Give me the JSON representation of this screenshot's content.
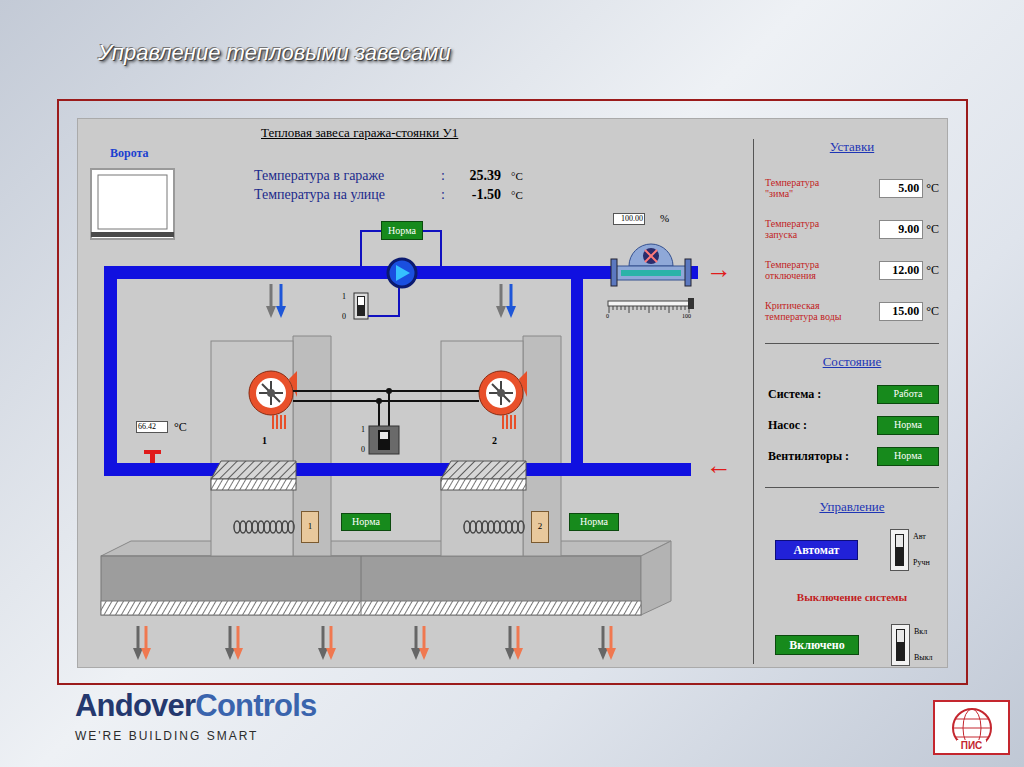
{
  "slide": {
    "title": "Управление тепловыми завесами"
  },
  "diagram": {
    "title": "Тепловая завеса гаража-стоянки У1",
    "gate": {
      "label": "Ворота"
    },
    "readings": [
      {
        "label": "Температура в гараже",
        "separator": ":",
        "value": "25.39",
        "unit": "°C"
      },
      {
        "label": "Температура на улице",
        "separator": ":",
        "value": "-1.50",
        "unit": "°C"
      }
    ],
    "pump": {
      "status": "Норма",
      "switch": {
        "on_label": "1",
        "off_label": "0",
        "on": true
      }
    },
    "valve": {
      "value": "100.00",
      "unit": "%",
      "level": 1,
      "scale_min": "0",
      "scale_max": "100"
    },
    "flow": {
      "supply_arrow": "→",
      "return_arrow": "←"
    },
    "water_temperature": {
      "value": "66.42",
      "unit": "°C"
    },
    "fan_switch": {
      "on_label": "1",
      "off_label": "0",
      "on": true
    },
    "units": [
      {
        "number": "1",
        "heater_label": "1",
        "status": "Норма"
      },
      {
        "number": "2",
        "heater_label": "2",
        "status": "Норма"
      }
    ]
  },
  "setpoints": {
    "title": "Уставки",
    "items": [
      {
        "label_lines": [
          "Температура",
          "\"зима\""
        ],
        "value": "5.00",
        "unit": "°C"
      },
      {
        "label_lines": [
          "Температура",
          "запуска"
        ],
        "value": "9.00",
        "unit": "°C"
      },
      {
        "label_lines": [
          "Температура",
          "отключения"
        ],
        "value": "12.00",
        "unit": "°C"
      },
      {
        "label_lines": [
          "Критическая",
          "температура воды"
        ],
        "value": "15.00",
        "unit": "°C"
      }
    ]
  },
  "status": {
    "title": "Состояние",
    "items": [
      {
        "label": "Система :",
        "value": "Работа"
      },
      {
        "label": "Насос :",
        "value": "Норма"
      },
      {
        "label": "Вентиляторы :",
        "value": "Норма"
      }
    ]
  },
  "control": {
    "title": "Управление",
    "mode_button": "Автомат",
    "switch": {
      "up_label": "Авт",
      "down_label": "Ручн",
      "up": true
    }
  },
  "shutdown": {
    "title": "Выключение системы",
    "state_button": "Включено",
    "switch": {
      "up_label": "Вкл",
      "down_label": "Выкл",
      "up": true
    }
  },
  "footer": {
    "brand_first": "Andover",
    "brand_second": "Controls",
    "tagline": "WE'RE BUILDING SMART",
    "partner_logo_text": "ПИС"
  }
}
